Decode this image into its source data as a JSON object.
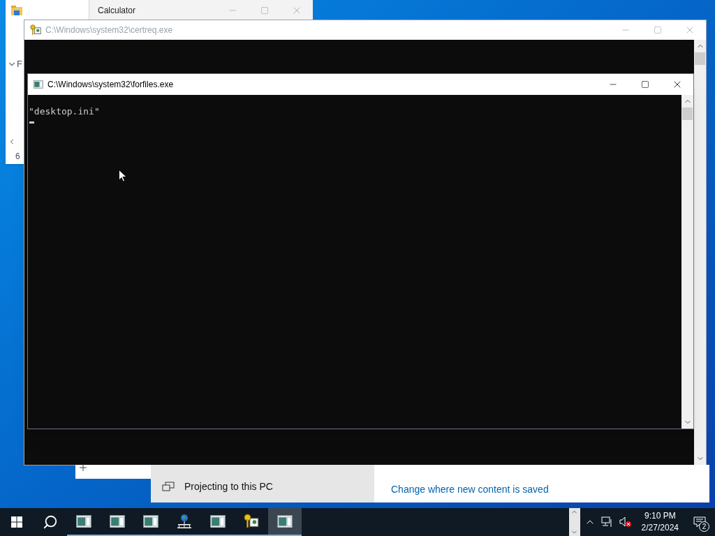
{
  "explorer": {
    "collapsed_label": "F",
    "status": "6"
  },
  "calculator": {
    "title": "Calculator",
    "active": false
  },
  "certreq": {
    "title": "C:\\Windows\\system32\\certreq.exe",
    "active": false
  },
  "forfiles": {
    "title": "C:\\Windows\\system32\\forfiles.exe",
    "active": true,
    "lines": [
      "\"desktop.ini\""
    ]
  },
  "settings": {
    "item": "Projecting to this PC",
    "link": "Change where new content is saved"
  },
  "taskbar": {
    "apps": [
      {
        "kind": "console",
        "selected": false
      },
      {
        "kind": "console",
        "selected": false
      },
      {
        "kind": "console",
        "selected": false
      },
      {
        "kind": "network",
        "selected": false
      },
      {
        "kind": "console",
        "selected": false
      },
      {
        "kind": "certificate",
        "selected": false
      },
      {
        "kind": "console",
        "selected": true
      }
    ],
    "time": "9:10 PM",
    "date": "2/27/2024",
    "notifications": "2"
  }
}
